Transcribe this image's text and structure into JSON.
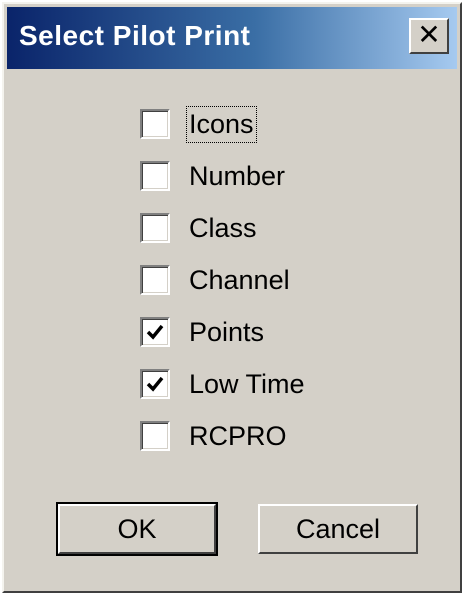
{
  "window": {
    "title": "Select  Pilot Print",
    "close_glyph": "✕"
  },
  "options": [
    {
      "label": "Icons",
      "checked": false,
      "focused": true
    },
    {
      "label": "Number",
      "checked": false,
      "focused": false
    },
    {
      "label": "Class",
      "checked": false,
      "focused": false
    },
    {
      "label": "Channel",
      "checked": false,
      "focused": false
    },
    {
      "label": "Points",
      "checked": true,
      "focused": false
    },
    {
      "label": "Low Time",
      "checked": true,
      "focused": false
    },
    {
      "label": "RCPRO",
      "checked": false,
      "focused": false
    }
  ],
  "buttons": {
    "ok_label": "OK",
    "cancel_label": "Cancel"
  },
  "colors": {
    "dialog_bg": "#d4d0c8",
    "titlebar_start": "#0a246a",
    "titlebar_end": "#a6caf0",
    "title_text": "#ffffff"
  }
}
